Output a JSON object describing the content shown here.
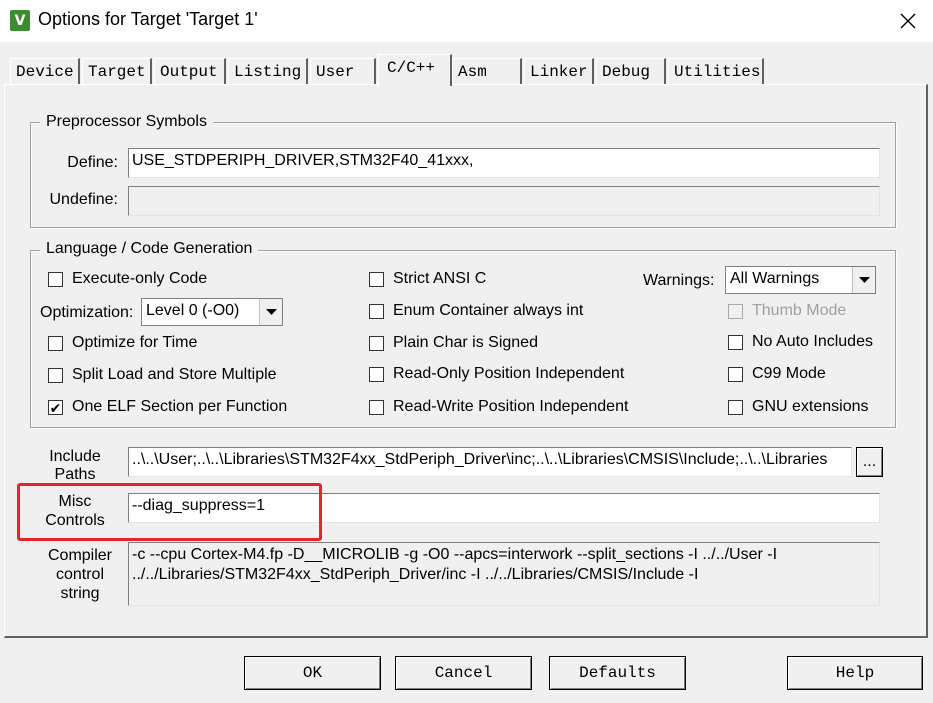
{
  "window": {
    "title": "Options for Target 'Target 1'",
    "icon": "keil-uvision-icon",
    "close_icon": "close-icon"
  },
  "tabs": [
    {
      "label": "Device"
    },
    {
      "label": "Target"
    },
    {
      "label": "Output"
    },
    {
      "label": "Listing"
    },
    {
      "label": "User"
    },
    {
      "label": "C/C++",
      "active": true
    },
    {
      "label": "Asm"
    },
    {
      "label": "Linker"
    },
    {
      "label": "Debug"
    },
    {
      "label": "Utilities"
    }
  ],
  "preprocessor": {
    "title": "Preprocessor Symbols",
    "define_label": "Define:",
    "define_value": "USE_STDPERIPH_DRIVER,STM32F40_41xxx,",
    "undefine_label": "Undefine:",
    "undefine_value": ""
  },
  "language": {
    "title": "Language / Code Generation",
    "execute_only": {
      "label": "Execute-only Code",
      "checked": false
    },
    "optimization_label": "Optimization:",
    "optimization_value": "Level 0 (-O0)",
    "optimize_time": {
      "label": "Optimize for Time",
      "checked": false
    },
    "split_load": {
      "label": "Split Load and Store Multiple",
      "checked": false
    },
    "one_elf": {
      "label": "One ELF Section per Function",
      "checked": true
    },
    "strict_ansi": {
      "label": "Strict ANSI C",
      "checked": false
    },
    "enum_container": {
      "label": "Enum Container always int",
      "checked": false
    },
    "plain_char": {
      "label": "Plain Char is Signed",
      "checked": false
    },
    "ro_pos": {
      "label": "Read-Only Position Independent",
      "checked": false
    },
    "rw_pos": {
      "label": "Read-Write Position Independent",
      "checked": false
    },
    "warnings_label": "Warnings:",
    "warnings_value": "All Warnings",
    "thumb_mode": {
      "label": "Thumb Mode",
      "checked": false,
      "disabled": true
    },
    "no_auto_includes": {
      "label": "No Auto Includes",
      "checked": false
    },
    "c99_mode": {
      "label": "C99 Mode",
      "checked": false
    },
    "gnu_ext": {
      "label": "GNU extensions",
      "checked": false
    }
  },
  "include_paths": {
    "label_line1": "Include",
    "label_line2": "Paths",
    "value": "..\\..\\User;..\\..\\Libraries\\STM32F4xx_StdPeriph_Driver\\inc;..\\..\\Libraries\\CMSIS\\Include;..\\..\\Libraries",
    "browse_label": "..."
  },
  "misc_controls": {
    "label_line1": "Misc",
    "label_line2": "Controls",
    "value": "--diag_suppress=1"
  },
  "compiler_string": {
    "label_line1": "Compiler",
    "label_line2": "control",
    "label_line3": "string",
    "value": "-c --cpu Cortex-M4.fp -D__MICROLIB -g -O0 --apcs=interwork --split_sections -I ../../User -I ../../Libraries/STM32F4xx_StdPeriph_Driver/inc -I ../../Libraries/CMSIS/Include -I"
  },
  "buttons": {
    "ok": "OK",
    "cancel": "Cancel",
    "defaults": "Defaults",
    "help": "Help"
  },
  "colors": {
    "highlight": "#e8232a",
    "icon_green": "#3a8d2f"
  }
}
